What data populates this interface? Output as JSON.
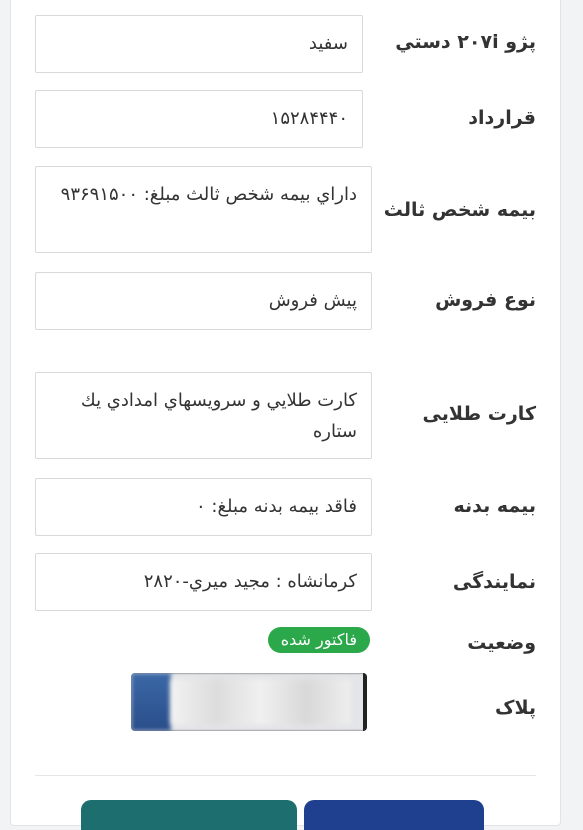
{
  "fields": [
    {
      "label": "پژو ۲۰۷i دستي",
      "value": "سفيد"
    },
    {
      "label": "قرارداد",
      "value": "۱۵۲۸۴۴۴۰"
    },
    {
      "label": "بيمه شخص ثالث",
      "value": "داراي بيمه شخص ثالث مبلغ: ۹۳۶۹۱۵۰۰"
    },
    {
      "label": "نوع فروش",
      "value": "پيش فروش"
    },
    {
      "label": "کارت طلایی",
      "value": "کارت طلايي و سرويسهاي امدادي يك ستاره"
    },
    {
      "label": "بیمه بدنه",
      "value": "فاقد بيمه بدنه مبلغ: ۰"
    },
    {
      "label": "نمایندگی",
      "value": "كرمانشاه : مجيد ميري-۲۸۲۰"
    }
  ],
  "status": {
    "label": "وضعیت",
    "badge": "فاکتور شده",
    "badge_color": "#2aa84a"
  },
  "plate": {
    "label": "پلاک"
  },
  "buttons": {
    "primary_color": "#1f3f8f",
    "secondary_color": "#1c6e6f"
  }
}
